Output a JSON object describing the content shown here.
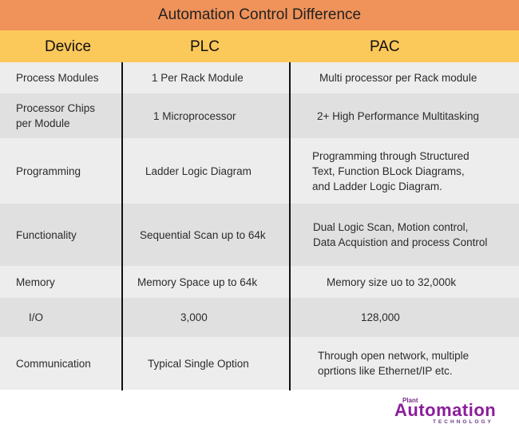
{
  "title": "Automation Control Difference",
  "columns": [
    "Device",
    "PLC",
    "PAC"
  ],
  "rows": [
    {
      "device": [
        "Process Modules"
      ],
      "plc": [
        "1 Per Rack Module"
      ],
      "pac": [
        "Multi processor per Rack module"
      ]
    },
    {
      "device": [
        "Processor Chips",
        "per Module"
      ],
      "plc": [
        "1 Microprocessor"
      ],
      "pac": [
        "2+ High Performance Multitasking"
      ]
    },
    {
      "device": [
        "Programming"
      ],
      "plc": [
        "Ladder Logic Diagram"
      ],
      "pac": [
        "Programming through Structured",
        "Text, Function BLock Diagrams,",
        "and Ladder Logic Diagram."
      ]
    },
    {
      "device": [
        "Functionality"
      ],
      "plc": [
        "Sequential Scan up to 64k"
      ],
      "pac": [
        "Dual Logic Scan, Motion control,",
        "Data Acquistion and process Control"
      ]
    },
    {
      "device": [
        "Memory"
      ],
      "plc": [
        "Memory Space up to 64k"
      ],
      "pac": [
        "Memory size uo to 32,000k"
      ]
    },
    {
      "device": [
        "I/O"
      ],
      "plc": [
        "3,000"
      ],
      "pac": [
        "128,000"
      ]
    },
    {
      "device": [
        "Communication"
      ],
      "plc": [
        "Typical Single Option"
      ],
      "pac": [
        "Through open network, multiple",
        "oprtions like Ethernet/IP etc."
      ]
    }
  ],
  "logo": {
    "top": "Plant",
    "word": "Automation",
    "bottom": "TECHNOLOGY"
  },
  "colors": {
    "title_bg": "#f0935a",
    "header_bg": "#fbc85a",
    "row_light": "#ededed",
    "row_dark": "#e0e0e0",
    "logo": "#8a1e9a"
  }
}
